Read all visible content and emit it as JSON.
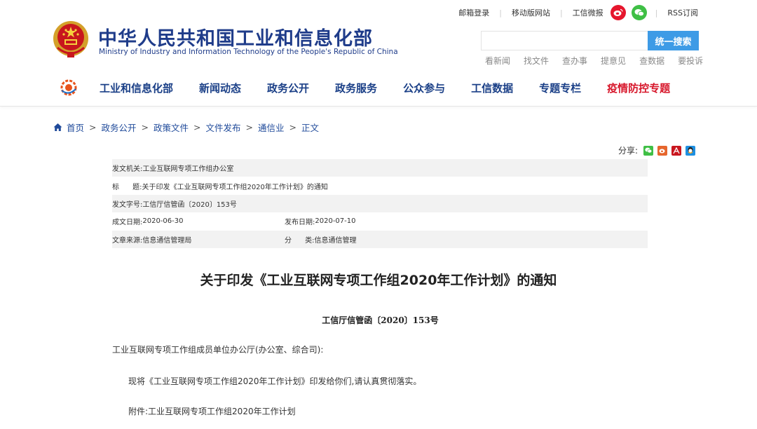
{
  "topbar": {
    "links": [
      "邮箱登录",
      "移动版网站",
      "工信微报"
    ],
    "rss": "RSS订阅",
    "weibo_icon": "weibo-icon",
    "wechat_icon": "wechat-icon"
  },
  "site": {
    "title": "中华人民共和国工业和信息化部",
    "subtitle": "Ministry of Industry and Information Technology of the People's Republic of China"
  },
  "search": {
    "value": "",
    "button": "统一搜索"
  },
  "quicklinks": [
    "看新闻",
    "找文件",
    "查办事",
    "提意见",
    "查数据",
    "要投诉"
  ],
  "nav": {
    "items": [
      "工业和信息化部",
      "新闻动态",
      "政务公开",
      "政务服务",
      "公众参与",
      "工信数据",
      "专题专栏"
    ],
    "highlight": "疫情防控专题",
    "highlight_color": "#d7172b",
    "color": "#1a3f87"
  },
  "breadcrumb": {
    "items": [
      "首页",
      "政务公开",
      "政策文件",
      "文件发布",
      "通信业"
    ],
    "current": "正文",
    "sep": ">"
  },
  "share": {
    "label": "分享:",
    "icons": [
      "wechat-icon",
      "weibo-icon",
      "pdf-icon",
      "qq-icon"
    ]
  },
  "meta": {
    "issuer_label": "发文机关:",
    "issuer": "工业互联网专项工作组办公室",
    "title_label": "标      题:",
    "title": "关于印发《工业互联网专项工作组2020年工作计划》的通知",
    "docno_label": "发文字号:",
    "docno": "工信厅信管函〔2020〕153号",
    "created_label": "成文日期:",
    "created": "2020-06-30",
    "published_label": "发布日期:",
    "published": "2020-07-10",
    "source_label": "文章来源:",
    "source": "信息通信管理局",
    "category_label": "分      类:",
    "category": "信息通信管理"
  },
  "article": {
    "title": "关于印发《工业互联网专项工作组2020年工作计划》的通知",
    "doc_no": "工信厅信管函〔2020〕153号",
    "para1": "工业互联网专项工作组成员单位办公厅(办公室、综合司):",
    "para2": "现将《工业互联网专项工作组2020年工作计划》印发给你们,请认真贯彻落实。",
    "para3": "附件:工业互联网专项工作组2020年工作计划"
  }
}
